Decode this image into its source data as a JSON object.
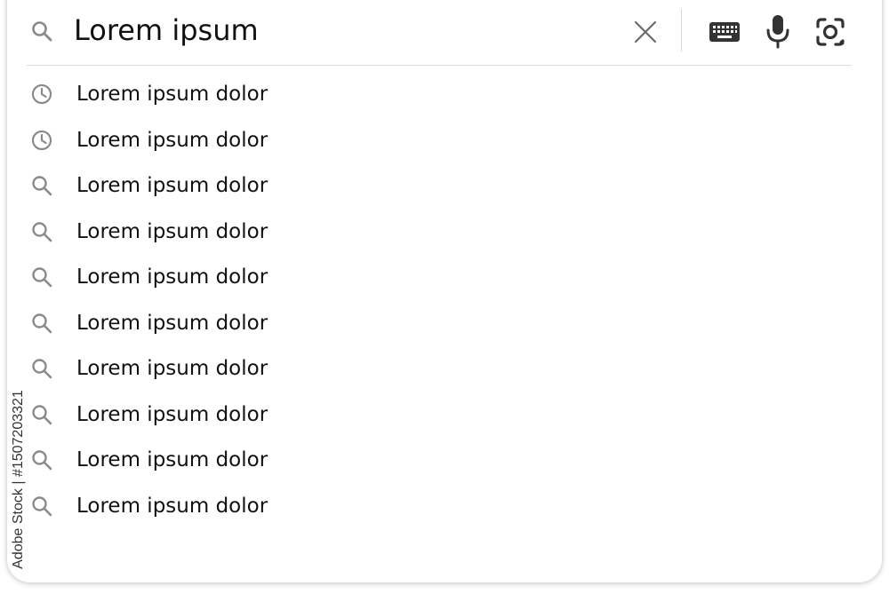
{
  "search": {
    "query": "Lorem ipsum",
    "icons": {
      "leading": "search-icon",
      "clear": "close-icon",
      "keyboard": "keyboard-icon",
      "voice": "microphone-icon",
      "lens": "camera-lens-icon"
    }
  },
  "suggestions": [
    {
      "icon": "history-icon",
      "label": "Lorem ipsum dolor"
    },
    {
      "icon": "history-icon",
      "label": "Lorem ipsum dolor"
    },
    {
      "icon": "search-icon",
      "label": "Lorem ipsum dolor"
    },
    {
      "icon": "search-icon",
      "label": "Lorem ipsum dolor"
    },
    {
      "icon": "search-icon",
      "label": "Lorem ipsum dolor"
    },
    {
      "icon": "search-icon",
      "label": "Lorem ipsum dolor"
    },
    {
      "icon": "search-icon",
      "label": "Lorem ipsum dolor"
    },
    {
      "icon": "search-icon",
      "label": "Lorem ipsum dolor"
    },
    {
      "icon": "search-icon",
      "label": "Lorem ipsum dolor"
    },
    {
      "icon": "search-icon",
      "label": "Lorem ipsum dolor"
    }
  ],
  "watermark": {
    "text": "Adobe Stock | #1507203321"
  },
  "colors": {
    "text": "#111111",
    "icon_muted": "#8a8a8a",
    "icon_dark": "#333333",
    "divider": "#dcdcdc"
  }
}
